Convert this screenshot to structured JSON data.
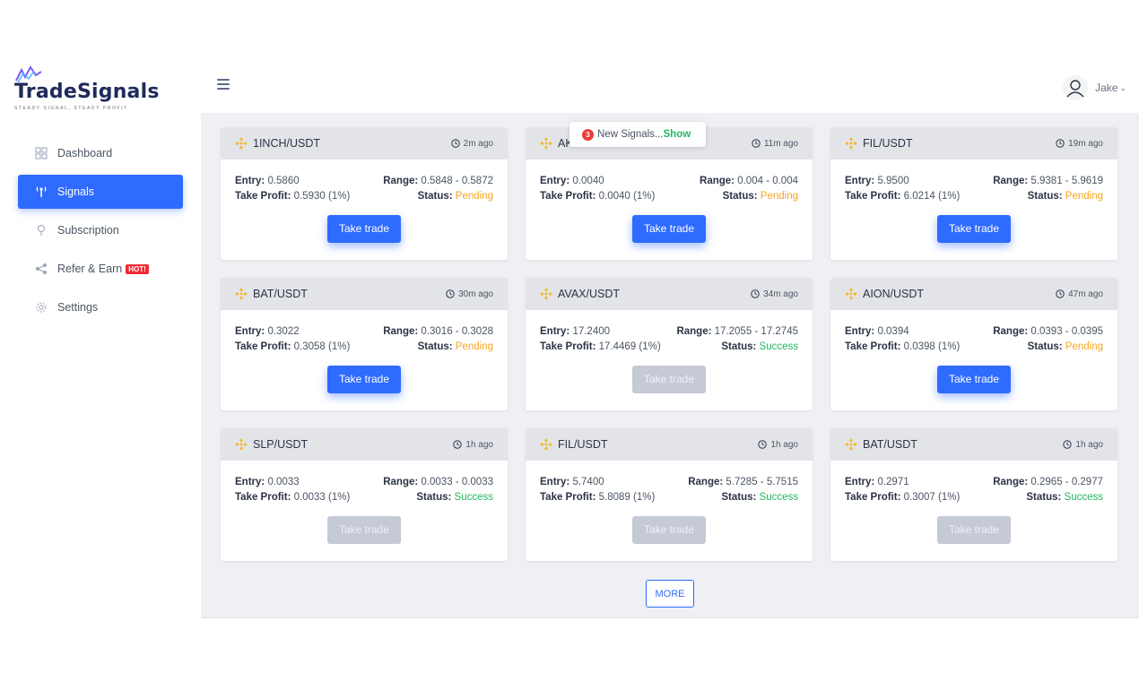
{
  "brand": {
    "name": "TradeSignals",
    "tagline": "STEADY SIGNAL, STEADY PROFIT",
    "accent_color": "#2f6bff"
  },
  "sidebar": {
    "items": [
      {
        "label": "Dashboard",
        "icon": "grid-icon",
        "active": false
      },
      {
        "label": "Signals",
        "icon": "antenna-icon",
        "active": true
      },
      {
        "label": "Subscription",
        "icon": "medal-icon",
        "active": false
      },
      {
        "label": "Refer & Earn",
        "icon": "share-icon",
        "active": false,
        "badge": "HOT!"
      },
      {
        "label": "Settings",
        "icon": "gear-icon",
        "active": false
      }
    ]
  },
  "header": {
    "user_name": "Jake"
  },
  "toast": {
    "count": "3",
    "text": "New Signals...",
    "action": "Show"
  },
  "labels": {
    "entry": "Entry:",
    "range": "Range:",
    "take_profit": "Take Profit:",
    "status": "Status:",
    "take_trade": "Take trade"
  },
  "signals": [
    {
      "pair": "1INCH/USDT",
      "time": "2m ago",
      "entry": "0.5860",
      "range": "0.5848 - 0.5872",
      "take_profit": "0.5930 (1%)",
      "status": "Pending",
      "enabled": true
    },
    {
      "pair": "AKRO/USDT",
      "time": "11m ago",
      "entry": "0.0040",
      "range": "0.004 - 0.004",
      "take_profit": "0.0040 (1%)",
      "status": "Pending",
      "enabled": true
    },
    {
      "pair": "FIL/USDT",
      "time": "19m ago",
      "entry": "5.9500",
      "range": "5.9381 - 5.9619",
      "take_profit": "6.0214 (1%)",
      "status": "Pending",
      "enabled": true
    },
    {
      "pair": "BAT/USDT",
      "time": "30m ago",
      "entry": "0.3022",
      "range": "0.3016 - 0.3028",
      "take_profit": "0.3058 (1%)",
      "status": "Pending",
      "enabled": true
    },
    {
      "pair": "AVAX/USDT",
      "time": "34m ago",
      "entry": "17.2400",
      "range": "17.2055 - 17.2745",
      "take_profit": "17.4469 (1%)",
      "status": "Success",
      "enabled": false
    },
    {
      "pair": "AION/USDT",
      "time": "47m ago",
      "entry": "0.0394",
      "range": "0.0393 - 0.0395",
      "take_profit": "0.0398 (1%)",
      "status": "Pending",
      "enabled": true
    },
    {
      "pair": "SLP/USDT",
      "time": "1h ago",
      "entry": "0.0033",
      "range": "0.0033 - 0.0033",
      "take_profit": "0.0033 (1%)",
      "status": "Success",
      "enabled": false
    },
    {
      "pair": "FIL/USDT",
      "time": "1h ago",
      "entry": "5.7400",
      "range": "5.7285 - 5.7515",
      "take_profit": "5.8089 (1%)",
      "status": "Success",
      "enabled": false
    },
    {
      "pair": "BAT/USDT",
      "time": "1h ago",
      "entry": "0.2971",
      "range": "0.2965 - 0.2977",
      "take_profit": "0.3007 (1%)",
      "status": "Success",
      "enabled": false
    }
  ],
  "more_button": "MORE"
}
